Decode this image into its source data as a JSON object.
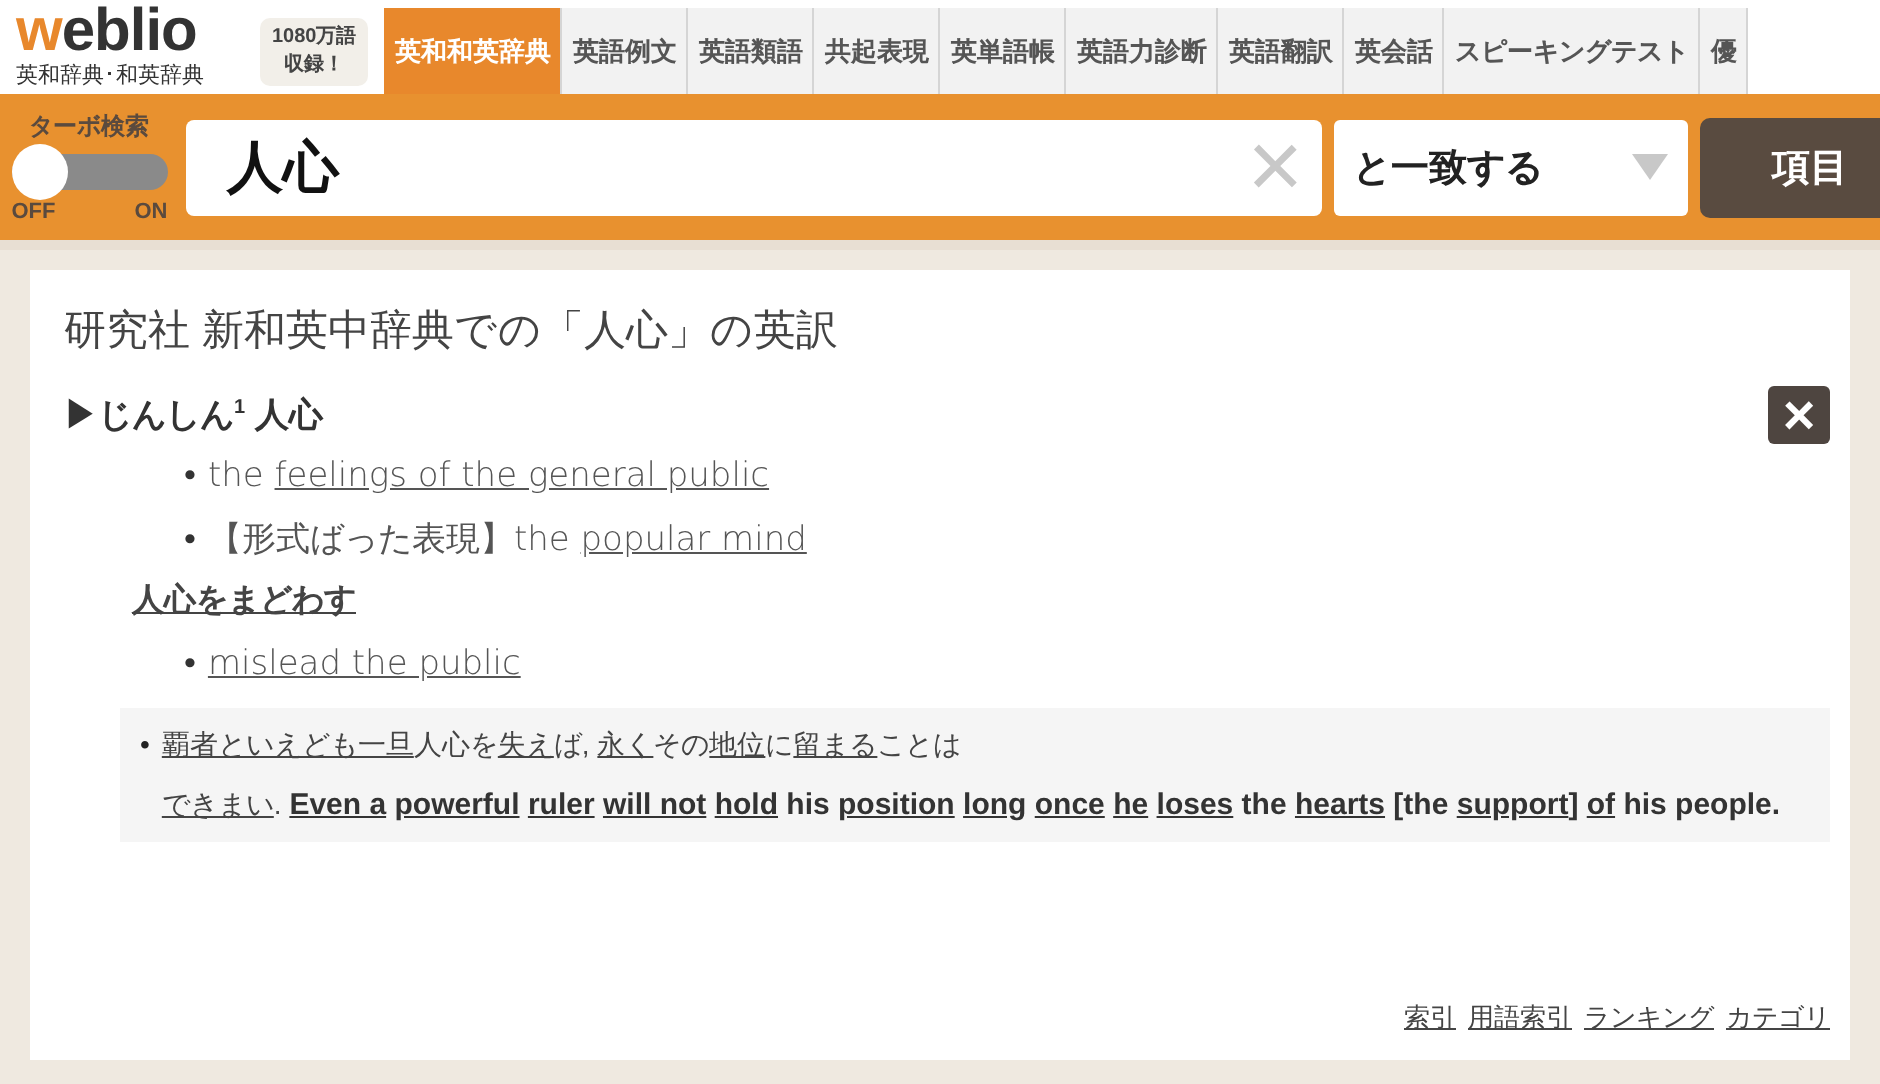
{
  "header": {
    "logo": "weblio",
    "logo_sub": "英和辞典･和英辞典",
    "badge": [
      "1080万語",
      "収録！"
    ],
    "tabs": [
      {
        "label": "英和和英辞典",
        "selected": true
      },
      {
        "label": "英語例文",
        "selected": false
      },
      {
        "label": "英語類語",
        "selected": false
      },
      {
        "label": "共起表現",
        "selected": false
      },
      {
        "label": "英単語帳",
        "selected": false
      },
      {
        "label": "英語力診断",
        "selected": false
      },
      {
        "label": "英語翻訳",
        "selected": false
      },
      {
        "label": "英会話",
        "selected": false
      },
      {
        "label": "スピーキングテスト",
        "selected": false
      },
      {
        "label": "優",
        "selected": false
      }
    ]
  },
  "search": {
    "turbo": {
      "label": "ターボ検索",
      "on": false,
      "off_label": "OFF",
      "on_label": "ON"
    },
    "value": "人心",
    "clear": "×",
    "match": "と一致する",
    "button": "項目"
  },
  "result": {
    "title": "研究社 新和英中辞典での「人心」の英訳",
    "close": "×",
    "heading": "▶じんしん$^{1}$ 人心",
    "senses": [
      {
        "marker": "•",
        "segments": [
          {
            "text": "the ",
            "link": false
          },
          {
            "text": "feelings of the general public",
            "link": true
          }
        ]
      },
      {
        "marker": "•",
        "segments": [
          {
            "text": "【形式ばった表現】the ",
            "link": false
          },
          {
            "text": "popular mind",
            "link": true
          }
        ]
      }
    ],
    "phrase": "人心をまどわす",
    "phrase_senses": [
      {
        "marker": "•",
        "segments": [
          {
            "text": "mislead the public",
            "link": true
          }
        ]
      }
    ],
    "example": {
      "marker": "•",
      "japanese": [
        {
          "text": "覇者といえども一旦",
          "link": true
        },
        {
          "text": "人心を",
          "link": false
        },
        {
          "text": "失え",
          "link": true
        },
        {
          "text": "ば, ",
          "link": false
        },
        {
          "text": "永く",
          "link": true
        },
        {
          "text": "その",
          "link": false
        },
        {
          "text": "地位",
          "link": true
        },
        {
          "text": "に",
          "link": false
        },
        {
          "text": "留まる",
          "link": true
        },
        {
          "text": "ことは",
          "link": false
        },
        {
          "text": "できまい",
          "link": true
        },
        {
          "text": ". ",
          "link": false
        }
      ],
      "english": [
        {
          "text": "Even a",
          "link": true
        },
        {
          "text": "powerful",
          "link": true
        },
        {
          "text": "ruler",
          "link": true
        },
        {
          "text": "will not",
          "link": true
        },
        {
          "text": "hold",
          "link": true
        },
        {
          "text": " his ",
          "link": false
        },
        {
          "text": "position",
          "link": true
        },
        {
          "text": "long",
          "link": true
        },
        {
          "text": "once",
          "link": true
        },
        {
          "text": "he",
          "link": true
        },
        {
          "text": "loses",
          "link": true
        },
        {
          "text": " the ",
          "link": false
        },
        {
          "text": "hearts",
          "link": true
        },
        {
          "text": " [the ",
          "link": false
        },
        {
          "text": "support",
          "link": true
        },
        {
          "text": "] ",
          "link": false
        },
        {
          "text": "of",
          "link": true
        },
        {
          "text": " his people.",
          "link": false
        }
      ]
    },
    "footer_links": [
      "索引",
      "用語索引",
      "ランキング",
      "カテゴリ"
    ]
  }
}
